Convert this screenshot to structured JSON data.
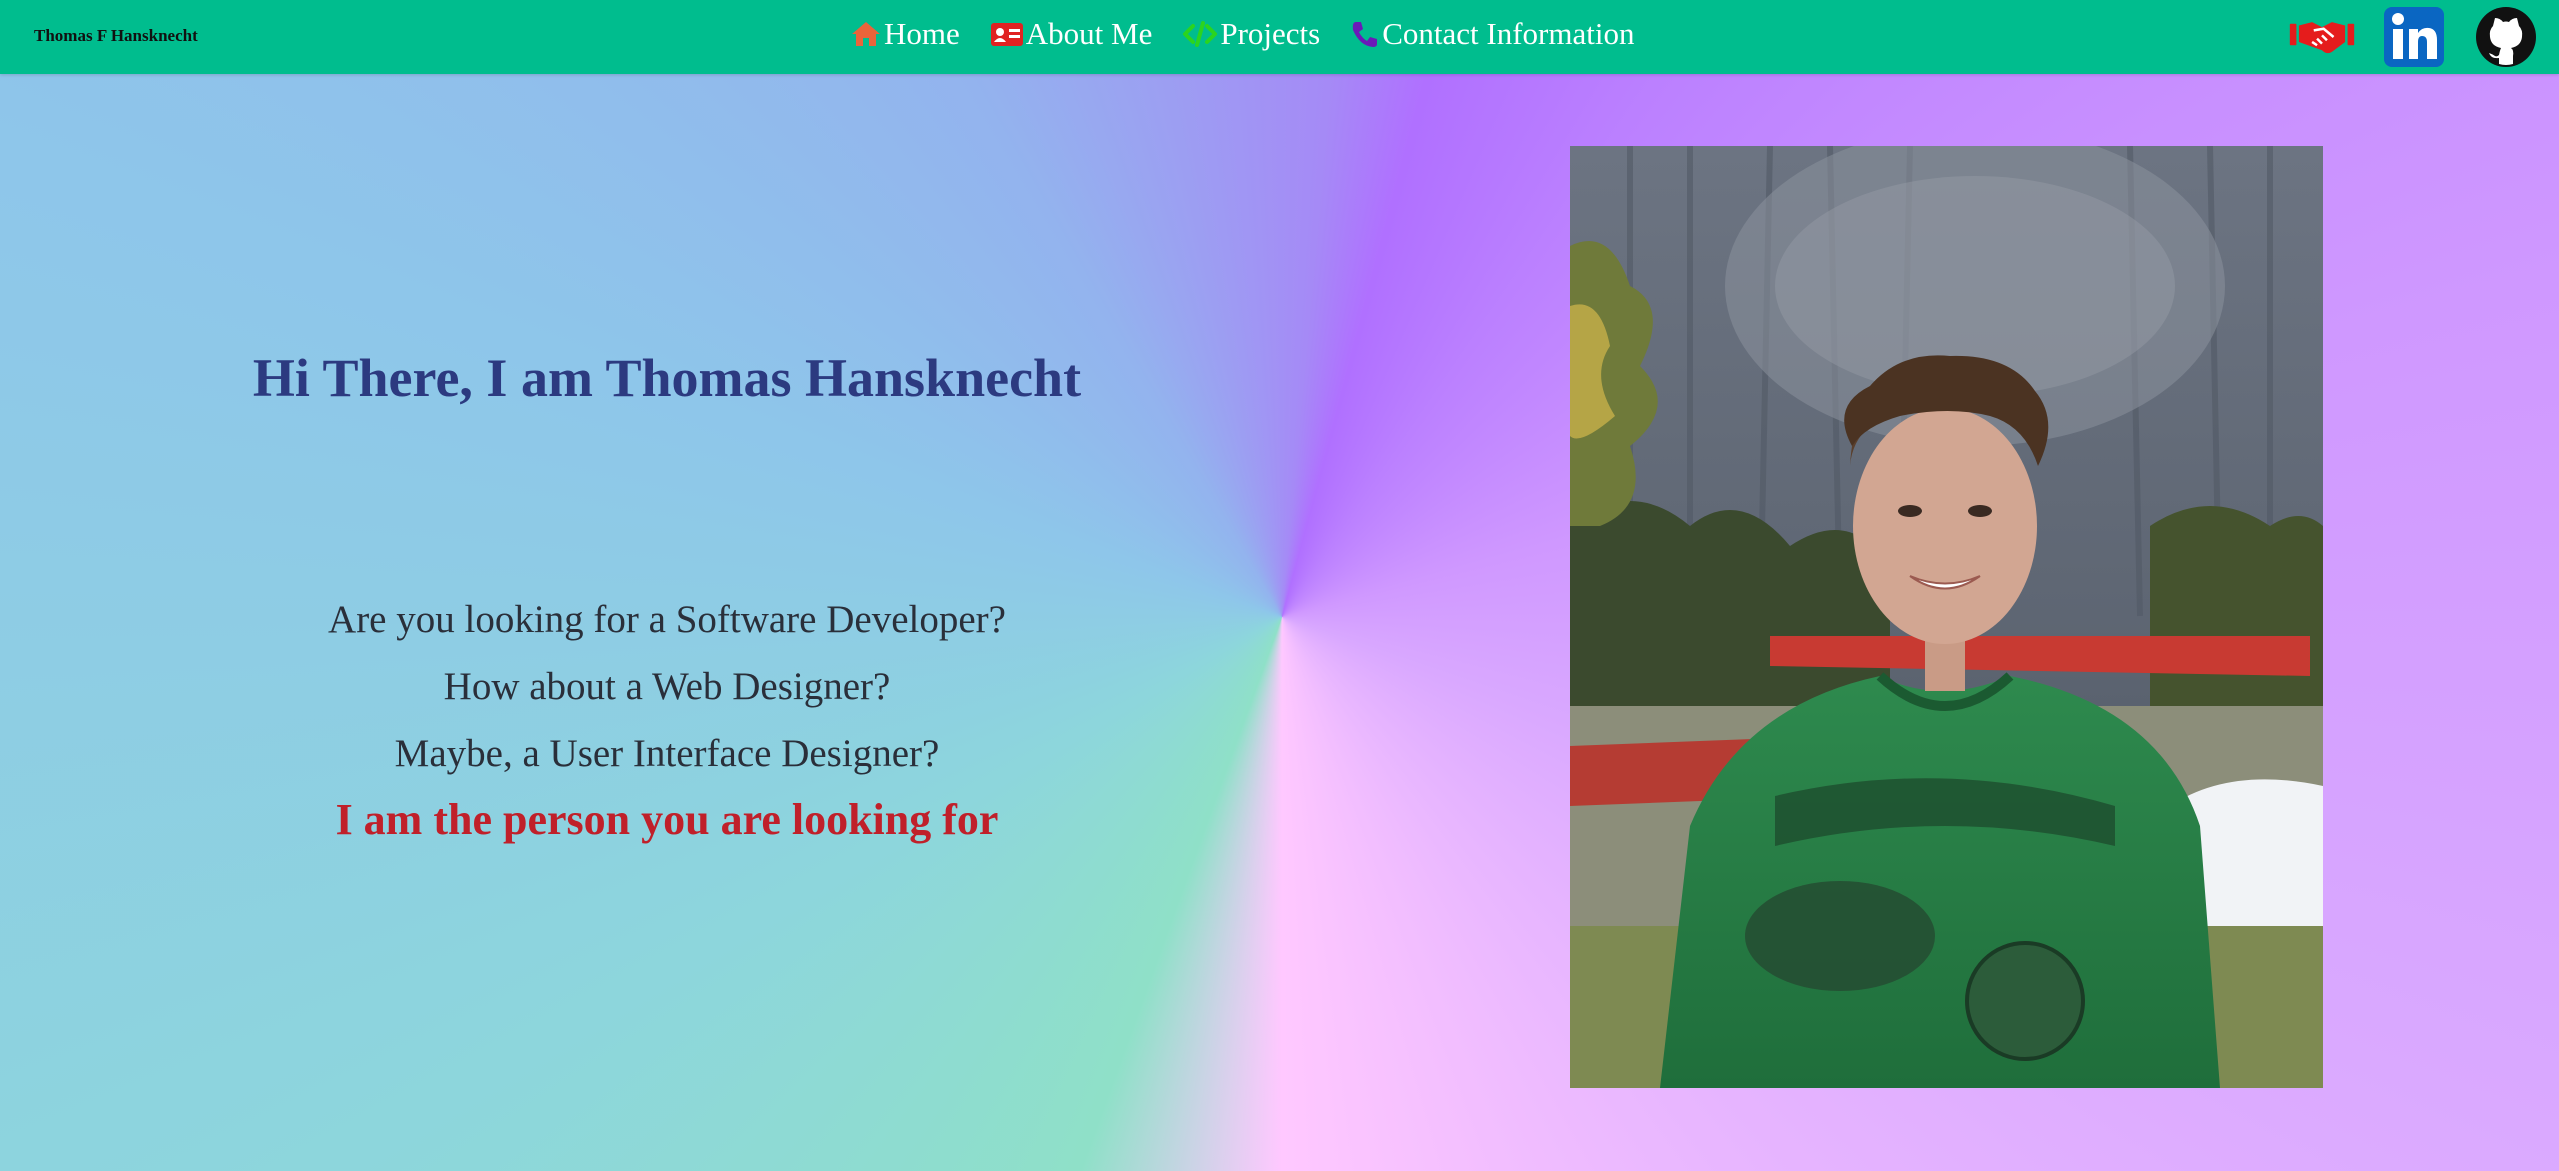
{
  "brand": {
    "name": "Thomas F Hansknecht"
  },
  "nav": {
    "items": [
      {
        "label": "Home",
        "icon": "home-icon",
        "color": "#e9643a"
      },
      {
        "label": "About Me",
        "icon": "id-card-icon",
        "color": "#e02222"
      },
      {
        "label": "Projects",
        "icon": "code-icon",
        "color": "#2bd41f"
      },
      {
        "label": "Contact Information",
        "icon": "phone-icon",
        "color": "#6a1bb8"
      }
    ]
  },
  "social": {
    "items": [
      {
        "icon": "handshake-icon",
        "color": "#e51c1c"
      },
      {
        "icon": "linkedin-icon",
        "color": "#0a66c2"
      },
      {
        "icon": "github-icon",
        "color": "#111111"
      }
    ]
  },
  "hero": {
    "title": "Hi There, I am Thomas Hansknecht",
    "lines": [
      "Are you looking for a Software Developer?",
      "How about a Web Designer?",
      "Maybe, a User Interface Designer?"
    ],
    "emphasis": "I am the person you are looking for"
  },
  "colors": {
    "navbar": "#00bd8e",
    "title": "#2c3a80",
    "emphasis": "#c0202a"
  }
}
